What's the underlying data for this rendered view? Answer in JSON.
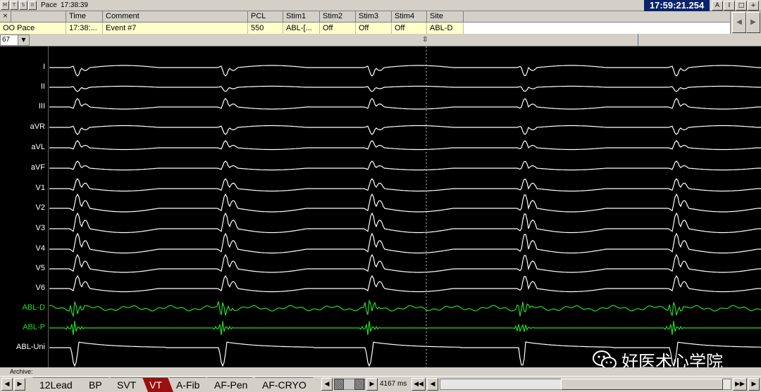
{
  "titlebar": {
    "buttons": [
      "M",
      "T",
      "S",
      "II"
    ],
    "title": "Pace",
    "time": "17:38:39",
    "clock": "17:59:21.254",
    "window_buttons": [
      "A",
      "I",
      "□",
      "+"
    ]
  },
  "event_grid": {
    "close_label": "×",
    "columns": [
      {
        "header": "",
        "value": "OO Pace"
      },
      {
        "header": "Time",
        "value": "17:38:..."
      },
      {
        "header": "Comment",
        "value": "Event #7"
      },
      {
        "header": "PCL",
        "value": "550"
      },
      {
        "header": "Stim1",
        "value": "ABL-[..."
      },
      {
        "header": "Stim2",
        "value": "Off"
      },
      {
        "header": "Stim3",
        "value": "Off"
      },
      {
        "header": "Stim4",
        "value": "Off"
      },
      {
        "header": "Site",
        "value": "ABL-D"
      }
    ],
    "scroll_left": "◀",
    "scroll_right": "▶"
  },
  "sweep": {
    "selected": "67",
    "dropdown_icon": "▼",
    "cursor_icon": "⇳"
  },
  "leads": [
    {
      "label": "I",
      "color": "#ffffff"
    },
    {
      "label": "II",
      "color": "#ffffff"
    },
    {
      "label": "III",
      "color": "#ffffff"
    },
    {
      "label": "aVR",
      "color": "#ffffff"
    },
    {
      "label": "aVL",
      "color": "#ffffff"
    },
    {
      "label": "aVF",
      "color": "#ffffff"
    },
    {
      "label": "V1",
      "color": "#ffffff"
    },
    {
      "label": "V2",
      "color": "#ffffff"
    },
    {
      "label": "V3",
      "color": "#ffffff"
    },
    {
      "label": "V4",
      "color": "#ffffff"
    },
    {
      "label": "V5",
      "color": "#ffffff"
    },
    {
      "label": "V6",
      "color": "#ffffff"
    },
    {
      "label": "ABL-D",
      "color": "#22dd22"
    },
    {
      "label": "ABL-P",
      "color": "#22dd22"
    },
    {
      "label": "ABL-Uni",
      "color": "#ffffff"
    }
  ],
  "watermark": {
    "text": "好医术心学院",
    "icon": "wechat-icon"
  },
  "archive": {
    "label": "Archive:"
  },
  "tabs": {
    "prev_icon": "◀",
    "next_icon": "▶",
    "items": [
      "12Lead",
      "BP",
      "SVT",
      "VT",
      "A-Fib",
      "AF-Pen",
      "AF-CRYO"
    ],
    "active": "VT",
    "window_ms": "4167 ms",
    "rewind_icon": "◀◀",
    "step_back_icon": "◀",
    "step_fwd_icon": "▶",
    "ffwd_icon": "▶▶"
  },
  "colors": {
    "trace_white": "#ffffff",
    "trace_green": "#22dd22",
    "active_tab": "#9a1010",
    "clock_bg": "#0a246a"
  }
}
